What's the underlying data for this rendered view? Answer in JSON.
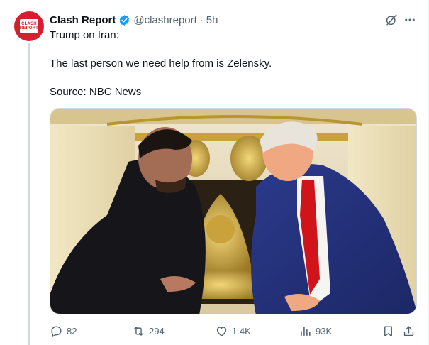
{
  "tweet": {
    "author_name": "Clash Report",
    "handle": "@clashreport",
    "separator": "·",
    "time": "5h",
    "avatar_text": [
      "CLASH",
      "REPORT"
    ],
    "lines": [
      "Trump on Iran:",
      "The last person we need help from is Zelensky.",
      "Source: NBC News"
    ],
    "verified": true
  },
  "actions": {
    "replies": "82",
    "reposts": "294",
    "likes": "1.4K",
    "views": "93K"
  },
  "icons": {
    "reply": "reply-icon",
    "repost": "repost-icon",
    "like": "heart-icon",
    "views": "views-chart-icon",
    "bookmark": "bookmark-icon",
    "share": "share-icon",
    "grok": "grok-icon",
    "more": "more-icon"
  },
  "colors": {
    "brand_red": "#d51f2e",
    "verified_blue": "#1d9bf0",
    "secondary_text": "#536471",
    "primary_text": "#0f1419",
    "divider": "#cfd9de"
  }
}
